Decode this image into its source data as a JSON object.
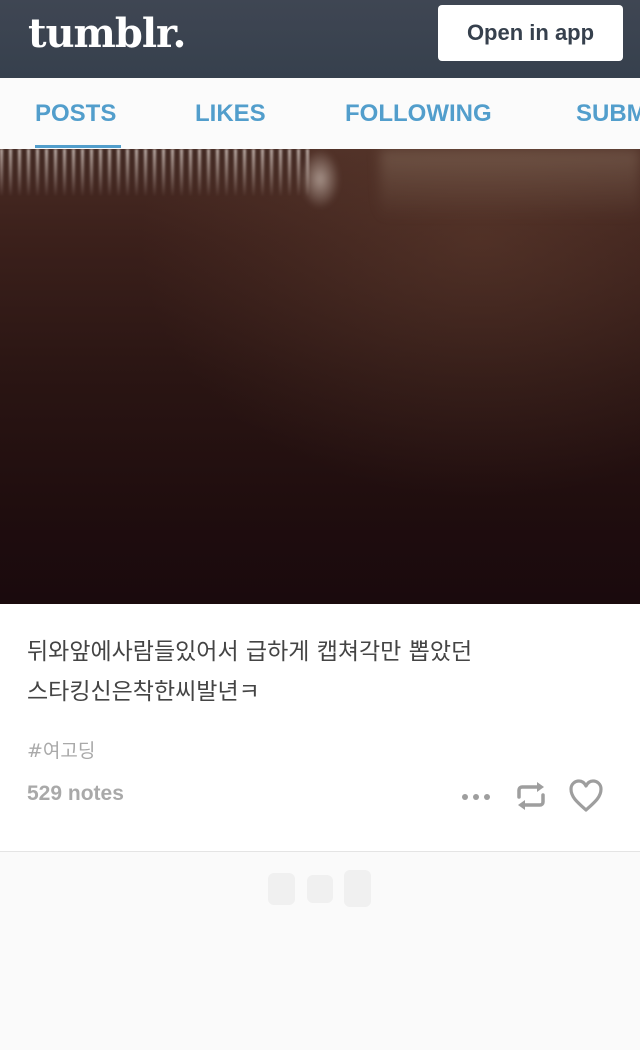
{
  "header": {
    "logo_text": "tumblr.",
    "open_in_app_label": "Open in app"
  },
  "tabs": [
    {
      "label": "POSTS",
      "active": true
    },
    {
      "label": "LIKES",
      "active": false
    },
    {
      "label": "FOLLOWING",
      "active": false
    },
    {
      "label": "SUBMIT",
      "active": false
    }
  ],
  "post": {
    "caption_line1": "뒤와앞에사람들있어서 급하게 캡쳐각만 뽑았던",
    "caption_line2": "스타킹신은착한씨발년ㅋ",
    "tag": "#여고딩",
    "notes": "529 notes",
    "actions": [
      "more-icon",
      "reblog-icon",
      "heart-icon"
    ]
  },
  "colors": {
    "header_bg": "#3a424f",
    "accent": "#529ecc",
    "muted_text": "#a9a9a9",
    "icon": "#9e9e9e"
  }
}
